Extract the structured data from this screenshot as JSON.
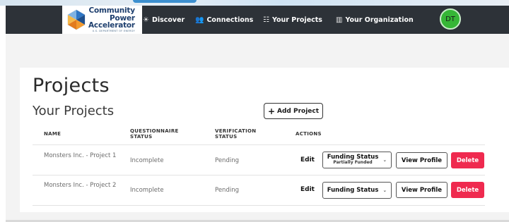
{
  "brand": {
    "line1": "Community",
    "line2": "Power",
    "line3": "Accelerator",
    "tagline": "U.S. DEPARTMENT OF ENERGY"
  },
  "nav": [
    {
      "label": "Discover",
      "icon": "sun-icon"
    },
    {
      "label": "Connections",
      "icon": "users-icon"
    },
    {
      "label": "Your Projects",
      "icon": "projects-icon"
    },
    {
      "label": "Your Organization",
      "icon": "building-icon"
    }
  ],
  "user": {
    "initials": "DT",
    "avatar_color": "#36b636"
  },
  "page": {
    "title": "Projects",
    "section_title": "Your Projects",
    "add_button": "Add Project"
  },
  "table": {
    "headers": {
      "name": "NAME",
      "questionnaire_1": "QUESTIONNAIRE",
      "questionnaire_2": "STATUS",
      "verification_1": "VERIFICATION",
      "verification_2": "STATUS",
      "actions": "ACTIONS"
    },
    "rows": [
      {
        "name": "Monsters Inc. - Project 1",
        "questionnaire": "Incomplete",
        "verification": "Pending",
        "edit": "Edit",
        "funding_label": "Funding Status",
        "funding_sub": "Partially Funded",
        "view": "View Profile",
        "delete": "Delete"
      },
      {
        "name": "Monsters Inc. - Project 2",
        "questionnaire": "Incomplete",
        "verification": "Pending",
        "edit": "Edit",
        "funding_label": "Funding Status",
        "funding_sub": "",
        "view": "View Profile",
        "delete": "Delete"
      }
    ]
  },
  "colors": {
    "header_bg": "#2d3238",
    "delete": "#ef2a4f",
    "brand_blue": "#1e3f6e"
  }
}
